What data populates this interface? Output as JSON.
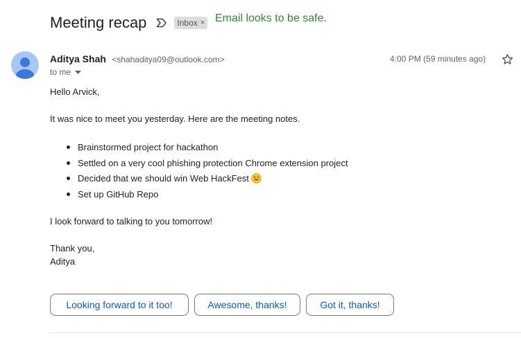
{
  "header": {
    "subject": "Meeting recap",
    "label_chip": "Inbox",
    "label_remove": "×",
    "safety_message": "Email looks to be safe."
  },
  "sender": {
    "name": "Aditya Shah",
    "email": "<shahaditya09@outlook.com>",
    "recipient_summary": "to me",
    "time": "4:00 PM (59 minutes ago)"
  },
  "body": {
    "greeting": "Hello Arvick,",
    "intro": "It was nice to meet you yesterday. Here are the meeting notes.",
    "bullets": [
      "Brainstormed project for hackathon",
      "Settled on a very cool phishing protection Chrome extension project",
      "Decided that we should win Web HackFest",
      "Set up GitHub Repo"
    ],
    "closing_line": "I look forward to talking to you tomorrow!",
    "signoff": "Thank you,",
    "signature": "Aditya"
  },
  "smart_replies": [
    "Looking forward to it too!",
    "Awesome, thanks!",
    "Got it, thanks!"
  ],
  "icons": {
    "important_marker": "important-marker-icon",
    "caret": "caret-down-icon",
    "star": "star-outline-icon",
    "emoji": "smiling-face-emoji",
    "avatar": "default-person-avatar"
  },
  "colors": {
    "safe_text": "#2f8a2f",
    "reply_text": "#0b57d0",
    "avatar_bg": "#a9c7f5",
    "avatar_fg": "#3b78d8"
  }
}
